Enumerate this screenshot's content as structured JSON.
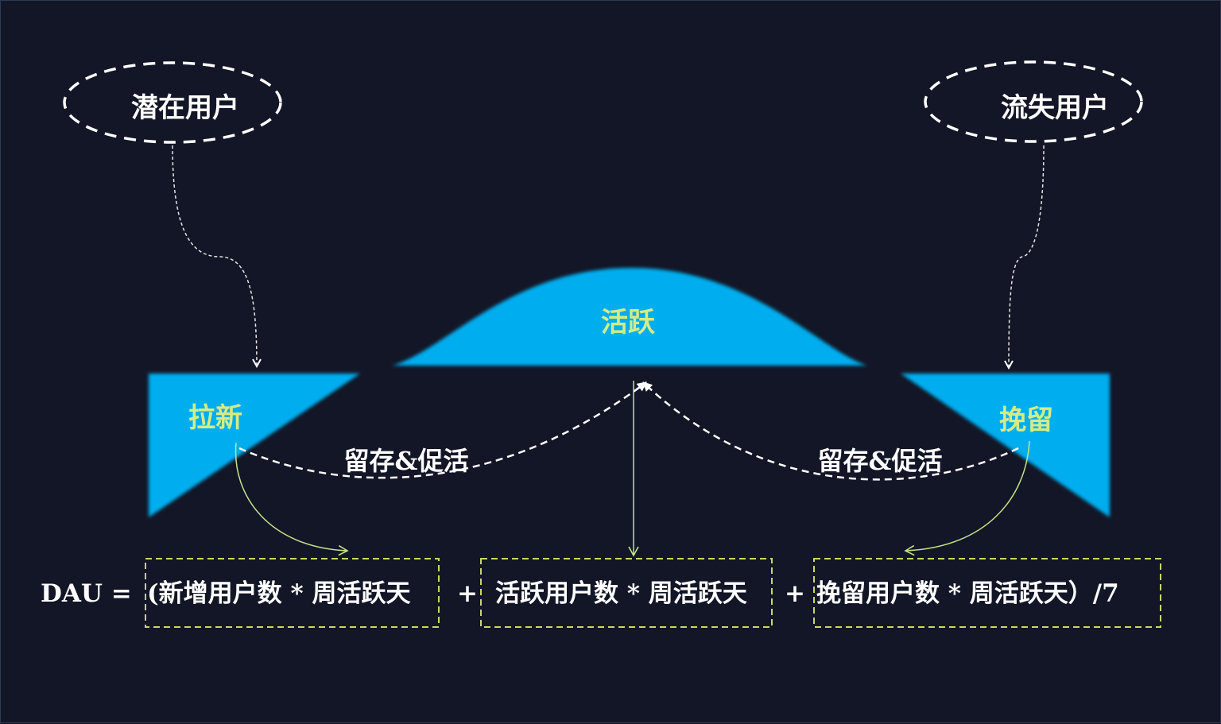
{
  "nodes": {
    "potential_users": "潜在用户",
    "churned_users": "流失用户",
    "acquisition": "拉新",
    "active": "活跃",
    "retention": "挽留"
  },
  "edges": {
    "left_retention": "留存&促活",
    "right_retention": "留存&促活"
  },
  "formula": {
    "prefix": "DAU =",
    "term1": "(新增用户数 * 周活跃天",
    "plus1": "+",
    "term2": "活跃用户数 * 周活跃天",
    "plus2": "+",
    "term3": "挽留用户数 * 周活跃天）/7"
  },
  "colors": {
    "background": "#121626",
    "shape_fill": "#00aeef",
    "highlight_text": "#d4ec84",
    "connector_green": "#c6e38a",
    "box_border": "#c6d86a"
  }
}
